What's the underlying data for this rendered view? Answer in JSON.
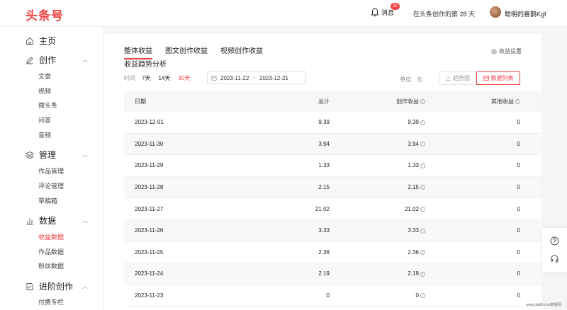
{
  "header": {
    "logo": "头条号",
    "message_label": "消息",
    "message_badge": "32",
    "days_text": "在头条创作的第 28 天",
    "username": "聪明的喜鹊Kgf"
  },
  "sidebar": {
    "home": "主页",
    "create": "创作",
    "create_items": [
      "文章",
      "视频",
      "微头条",
      "问答",
      "音频"
    ],
    "manage": "管理",
    "manage_items": [
      "作品管理",
      "评论管理",
      "草稿箱"
    ],
    "data": "数据",
    "data_items": [
      "收益数据",
      "作品数据",
      "粉丝数据"
    ],
    "advanced": "进阶创作",
    "advanced_items": [
      "付费专栏"
    ]
  },
  "tabs": [
    "整体收益",
    "图文创作收益",
    "视频创作收益"
  ],
  "settings_label": "收益设置",
  "section_title": "收益趋势分析",
  "filter": {
    "label": "时间",
    "options": [
      "7天",
      "14天",
      "30天"
    ],
    "start": "2023-11-22",
    "sep": "~",
    "end": "2023-12-21"
  },
  "unit_label": "单位：元",
  "btn_trend": "趋势图",
  "btn_table": "数据列表",
  "table": {
    "headers": [
      "日期",
      "总计",
      "创作收益",
      "其他收益"
    ],
    "rows": [
      [
        "2023-12-01",
        "9.39",
        "9.39",
        "0"
      ],
      [
        "2023-11-30",
        "3.94",
        "3.94",
        "0"
      ],
      [
        "2023-11-29",
        "1.33",
        "1.33",
        "0"
      ],
      [
        "2023-11-28",
        "2.15",
        "2.15",
        "0"
      ],
      [
        "2023-11-27",
        "21.02",
        "21.02",
        "0"
      ],
      [
        "2023-11-26",
        "3.33",
        "3.33",
        "0"
      ],
      [
        "2023-11-25",
        "2.36",
        "2.36",
        "0"
      ],
      [
        "2023-11-24",
        "2.19",
        "2.19",
        "0"
      ],
      [
        "2023-11-23",
        "0",
        "0",
        "0"
      ]
    ]
  },
  "watermark": "www.dadi9.com教程网",
  "colors": {
    "accent": "#f04142"
  }
}
